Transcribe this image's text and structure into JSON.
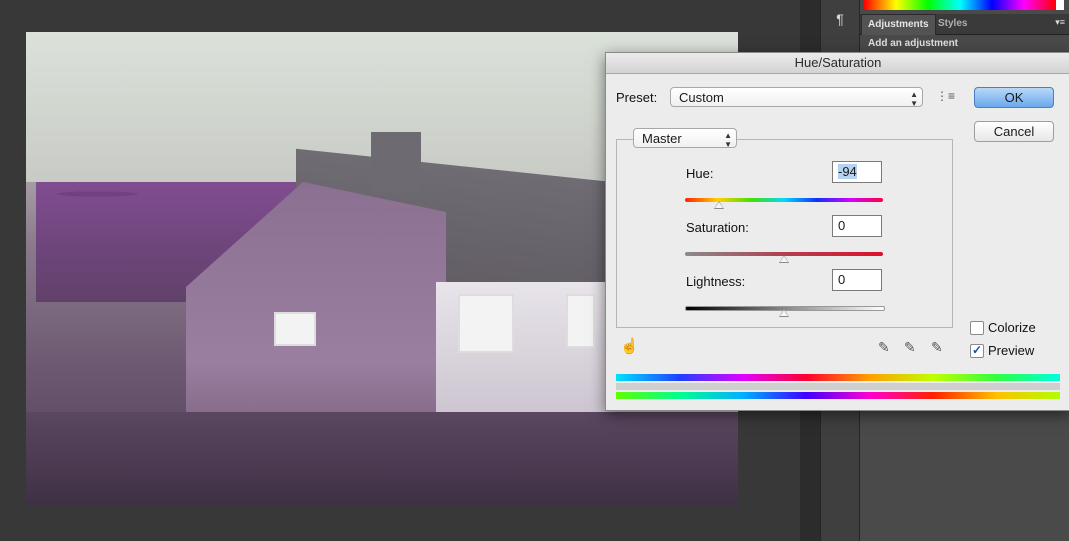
{
  "panel": {
    "tab_adjustments": "Adjustments",
    "tab_styles": "Styles",
    "add_adjustment": "Add an adjustment",
    "paragraph_icon": "¶"
  },
  "dialog": {
    "title": "Hue/Saturation",
    "preset_label": "Preset:",
    "preset_value": "Custom",
    "channel_value": "Master",
    "hue_label": "Hue:",
    "hue_value": "-94",
    "saturation_label": "Saturation:",
    "saturation_value": "0",
    "lightness_label": "Lightness:",
    "lightness_value": "0",
    "ok_label": "OK",
    "cancel_label": "Cancel",
    "colorize_label": "Colorize",
    "colorize_checked": false,
    "preview_label": "Preview",
    "preview_checked": true,
    "preview_check_glyph": "✓",
    "hue_level_percent": 17,
    "saturation_level_percent": 50,
    "lightness_level_percent": 50
  },
  "colors": {
    "accent": "#6aa9ec",
    "field_selection": "#b6d2f3"
  }
}
